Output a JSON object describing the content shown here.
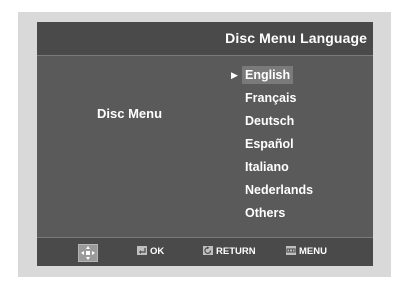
{
  "header": {
    "title": "Disc Menu Language"
  },
  "section_label": "Disc Menu",
  "languages": [
    "English",
    "Français",
    "Deutsch",
    "Español",
    "Italiano",
    "Nederlands",
    "Others"
  ],
  "selected_index": 0,
  "footer": {
    "ok_label": "OK",
    "return_label": "RETURN",
    "menu_label": "MENU"
  },
  "colors": {
    "screen": "#5a5a5a",
    "header": "#4a4a4a",
    "highlight": "#7a7a7a"
  },
  "icons": {
    "navigation": "dpad-icon",
    "ok": "enter-icon",
    "return": "return-icon",
    "menu": "menu-icon"
  }
}
